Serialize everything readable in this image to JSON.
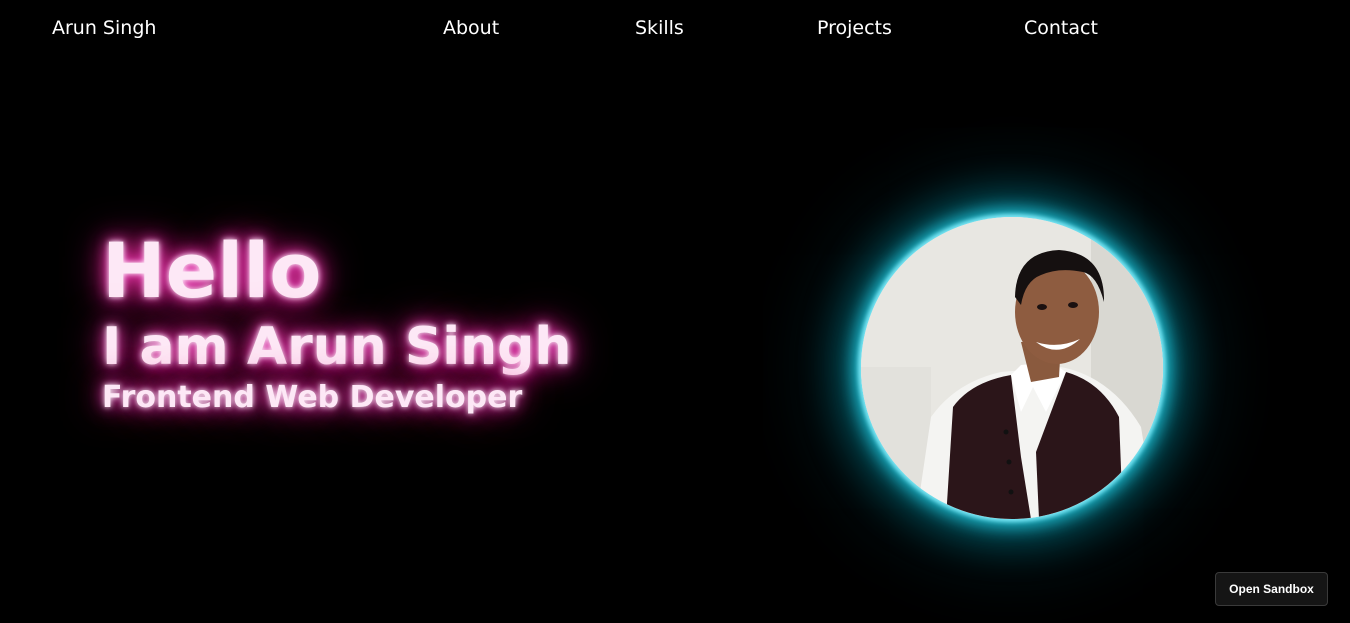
{
  "nav": {
    "brand": "Arun Singh",
    "links": [
      {
        "label": "About"
      },
      {
        "label": "Skills"
      },
      {
        "label": "Projects"
      },
      {
        "label": "Contact"
      }
    ]
  },
  "hero": {
    "greeting": "Hello",
    "name_line": "I am Arun Singh",
    "role": "Frontend Web Developer"
  },
  "profile_photo": {
    "icon": "profile-photo",
    "glow_color": "#1fb8cc"
  },
  "colors": {
    "background": "#000000",
    "text_glow": "#e0218a",
    "photo_glow": "#1fb8cc"
  },
  "sandbox": {
    "label": "Open Sandbox"
  }
}
